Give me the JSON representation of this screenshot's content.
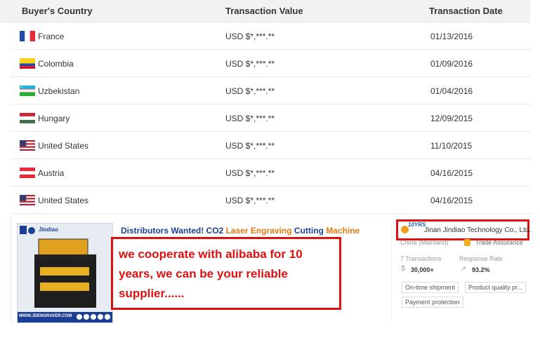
{
  "table": {
    "headers": {
      "country": "Buyer's Country",
      "value": "Transaction Value",
      "date": "Transaction Date"
    },
    "rows": [
      {
        "country": "France",
        "flag": "france-flag",
        "value": "USD $*,***.**",
        "date": "01/13/2016"
      },
      {
        "country": "Colombia",
        "flag": "colombia-flag",
        "value": "USD $*,***.**",
        "date": "01/09/2016"
      },
      {
        "country": "Uzbekistan",
        "flag": "uzbekistan-flag",
        "value": "USD $*,***.**",
        "date": "01/04/2016"
      },
      {
        "country": "Hungary",
        "flag": "hungary-flag",
        "value": "USD $*,***.**",
        "date": "12/09/2015"
      },
      {
        "country": "United States",
        "flag": "usa-flag",
        "value": "USD $*,***.**",
        "date": "11/10/2015"
      },
      {
        "country": "Austria",
        "flag": "austria-flag",
        "value": "USD $*,***.**",
        "date": "04/16/2015"
      },
      {
        "country": "United States",
        "flag": "usa-flag",
        "value": "USD $*,***.**",
        "date": "04/16/2015"
      }
    ]
  },
  "product": {
    "title_parts": [
      "Distributors Wanted! CO2 ",
      "Laser Engraving",
      " Cutting ",
      "Machine"
    ],
    "image_brand": "Jindiao",
    "image_url_text": "WWW.JDENGRAVER.COM"
  },
  "overlay_text": "we cooperate with alibaba for 10 years, we can be your reliable supplier......",
  "supplier": {
    "badge": "10YRS",
    "name": "Jinan Jindiao Technology Co., Ltd.",
    "location": "China (Mainland)",
    "trade_assurance": "Trade Assurance",
    "transactions_label": "7 Transactions",
    "transactions_value": "30,000+",
    "response_label": "Response Rate",
    "response_value": "93.2%",
    "tags": [
      "On-time shipment",
      "Product quality pr...",
      "Payment protection"
    ]
  },
  "colors": {
    "accent_red": "#dd1111",
    "title_blue": "#1c3f94",
    "title_orange": "#e47911"
  }
}
